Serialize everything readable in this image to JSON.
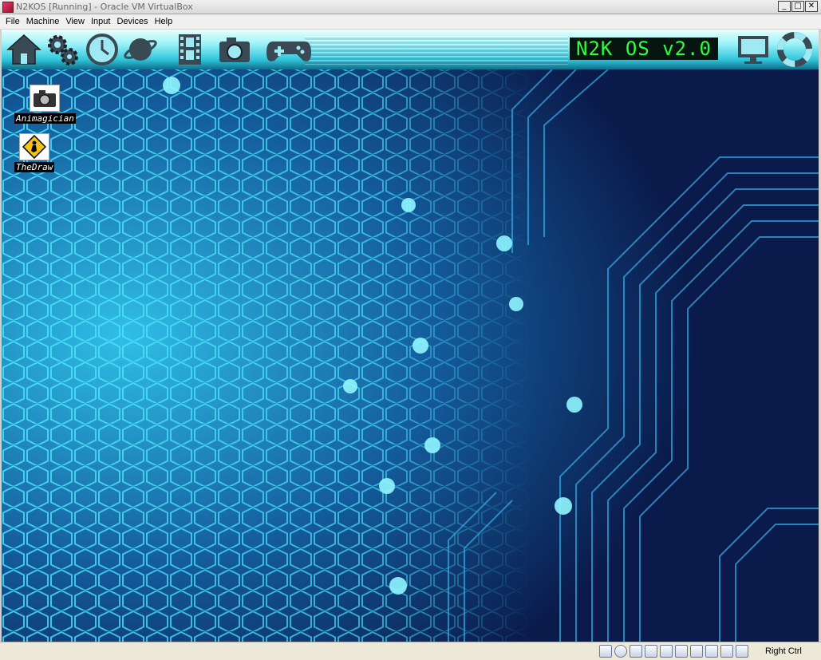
{
  "window": {
    "title": "N2KOS [Running] - Oracle VM VirtualBox",
    "controls": {
      "minimize": "_",
      "maximize": "□",
      "close": "✕"
    }
  },
  "menubar": {
    "items": [
      {
        "label": "File"
      },
      {
        "label": "Machine"
      },
      {
        "label": "View"
      },
      {
        "label": "Input"
      },
      {
        "label": "Devices"
      },
      {
        "label": "Help"
      }
    ]
  },
  "guest": {
    "brand_text": "N2K OS v2.0",
    "toolbar_icons": [
      "home-icon",
      "gear-icon",
      "clock-icon",
      "planet-icon",
      "film-icon",
      "camera-icon",
      "gamepad-icon"
    ],
    "right_icons": [
      "monitor-icon",
      "lifebuoy-icon"
    ],
    "desktop_icons": [
      {
        "label": "Animagician",
        "icon": "camera-icon"
      },
      {
        "label": "TheDraw",
        "icon": "construction-sign-icon"
      }
    ],
    "colors": {
      "accent": "#2cff3c",
      "bg_dark": "#0a1a4a",
      "hex": "#33d6f2"
    }
  },
  "statusbar": {
    "host_key": "Right Ctrl",
    "icons": [
      "hdd-icon",
      "cdrom-icon",
      "floppy-icon",
      "network-icon",
      "shared-folder-icon",
      "display-icon",
      "capture-icon",
      "usb-icon",
      "mouse-integration-icon",
      "arrow-down-icon"
    ]
  }
}
